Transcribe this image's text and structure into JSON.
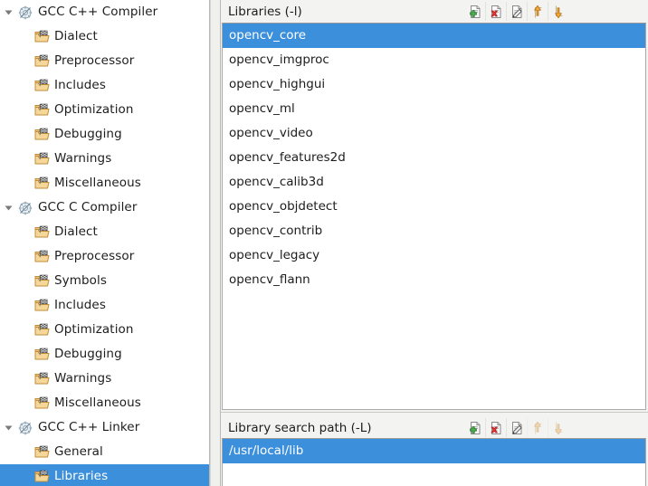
{
  "sidebar": {
    "items": [
      {
        "label": "GCC C++ Compiler",
        "level": 0,
        "icon": "gear-icon",
        "expanded": true,
        "selected": false
      },
      {
        "label": "Dialect",
        "level": 1,
        "icon": "folder-icon",
        "expanded": false,
        "selected": false
      },
      {
        "label": "Preprocessor",
        "level": 1,
        "icon": "folder-icon",
        "expanded": false,
        "selected": false
      },
      {
        "label": "Includes",
        "level": 1,
        "icon": "folder-icon",
        "expanded": false,
        "selected": false
      },
      {
        "label": "Optimization",
        "level": 1,
        "icon": "folder-icon",
        "expanded": false,
        "selected": false
      },
      {
        "label": "Debugging",
        "level": 1,
        "icon": "folder-icon",
        "expanded": false,
        "selected": false
      },
      {
        "label": "Warnings",
        "level": 1,
        "icon": "folder-icon",
        "expanded": false,
        "selected": false
      },
      {
        "label": "Miscellaneous",
        "level": 1,
        "icon": "folder-icon",
        "expanded": false,
        "selected": false
      },
      {
        "label": "GCC C Compiler",
        "level": 0,
        "icon": "gear-icon",
        "expanded": true,
        "selected": false
      },
      {
        "label": "Dialect",
        "level": 1,
        "icon": "folder-icon",
        "expanded": false,
        "selected": false
      },
      {
        "label": "Preprocessor",
        "level": 1,
        "icon": "folder-icon",
        "expanded": false,
        "selected": false
      },
      {
        "label": "Symbols",
        "level": 1,
        "icon": "folder-icon",
        "expanded": false,
        "selected": false
      },
      {
        "label": "Includes",
        "level": 1,
        "icon": "folder-icon",
        "expanded": false,
        "selected": false
      },
      {
        "label": "Optimization",
        "level": 1,
        "icon": "folder-icon",
        "expanded": false,
        "selected": false
      },
      {
        "label": "Debugging",
        "level": 1,
        "icon": "folder-icon",
        "expanded": false,
        "selected": false
      },
      {
        "label": "Warnings",
        "level": 1,
        "icon": "folder-icon",
        "expanded": false,
        "selected": false
      },
      {
        "label": "Miscellaneous",
        "level": 1,
        "icon": "folder-icon",
        "expanded": false,
        "selected": false
      },
      {
        "label": "GCC C++ Linker",
        "level": 0,
        "icon": "gear-icon",
        "expanded": true,
        "selected": false
      },
      {
        "label": "General",
        "level": 1,
        "icon": "folder-icon",
        "expanded": false,
        "selected": false
      },
      {
        "label": "Libraries",
        "level": 1,
        "icon": "folder-icon",
        "expanded": false,
        "selected": true
      }
    ]
  },
  "libraries_group": {
    "title": "Libraries (-l)",
    "toolbar": [
      {
        "name": "add-icon",
        "label": "Add",
        "disabled": false
      },
      {
        "name": "delete-icon",
        "label": "Delete",
        "disabled": false
      },
      {
        "name": "edit-icon",
        "label": "Edit",
        "disabled": false
      },
      {
        "name": "move-up-icon",
        "label": "Move Up",
        "disabled": false
      },
      {
        "name": "move-down-icon",
        "label": "Move Down",
        "disabled": false
      }
    ],
    "items": [
      {
        "value": "opencv_core",
        "selected": true
      },
      {
        "value": "opencv_imgproc",
        "selected": false
      },
      {
        "value": "opencv_highgui",
        "selected": false
      },
      {
        "value": "opencv_ml",
        "selected": false
      },
      {
        "value": "opencv_video",
        "selected": false
      },
      {
        "value": "opencv_features2d",
        "selected": false
      },
      {
        "value": "opencv_calib3d",
        "selected": false
      },
      {
        "value": "opencv_objdetect",
        "selected": false
      },
      {
        "value": "opencv_contrib",
        "selected": false
      },
      {
        "value": "opencv_legacy",
        "selected": false
      },
      {
        "value": "opencv_flann",
        "selected": false
      }
    ]
  },
  "search_path_group": {
    "title": "Library search path (-L)",
    "toolbar": [
      {
        "name": "add-icon",
        "label": "Add",
        "disabled": false
      },
      {
        "name": "delete-icon",
        "label": "Delete",
        "disabled": false
      },
      {
        "name": "edit-icon",
        "label": "Edit",
        "disabled": false
      },
      {
        "name": "move-up-icon",
        "label": "Move Up",
        "disabled": true
      },
      {
        "name": "move-down-icon",
        "label": "Move Down",
        "disabled": true
      }
    ],
    "items": [
      {
        "value": "/usr/local/lib",
        "selected": true
      }
    ]
  },
  "colors": {
    "selection": "#3b8fdb",
    "selection_text": "#ffffff",
    "panel_bg": "#f3f3f1",
    "list_bg": "#ffffff",
    "text": "#1d1d1d",
    "border": "#a9a9a9"
  }
}
